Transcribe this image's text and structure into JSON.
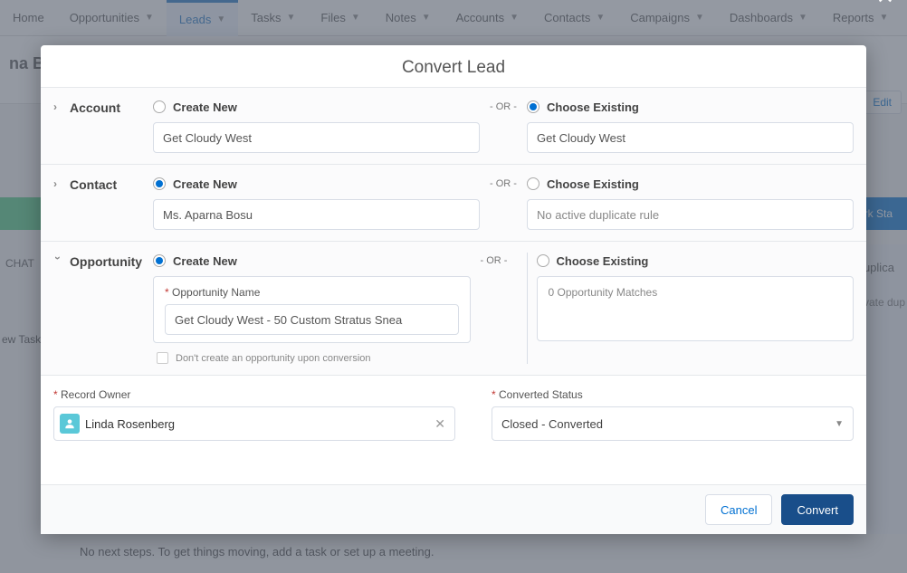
{
  "nav": {
    "items": [
      {
        "label": "Home",
        "dd": false
      },
      {
        "label": "Opportunities",
        "dd": true
      },
      {
        "label": "Leads",
        "dd": true,
        "active": true
      },
      {
        "label": "Tasks",
        "dd": true
      },
      {
        "label": "Files",
        "dd": true
      },
      {
        "label": "Notes",
        "dd": true
      },
      {
        "label": "Accounts",
        "dd": true
      },
      {
        "label": "Contacts",
        "dd": true
      },
      {
        "label": "Campaigns",
        "dd": true
      },
      {
        "label": "Dashboards",
        "dd": true
      },
      {
        "label": "Reports",
        "dd": true
      }
    ]
  },
  "bg": {
    "lead_name": "na Bos",
    "edit_btn": "Edit",
    "mark_stage": "ark Sta",
    "chatter": "CHAT",
    "newtask": "ew Task",
    "duplicates_title": "uplica",
    "duplicates_sub": "vate dup",
    "next_steps": "No next steps. To get things moving, add a task or set up a meeting."
  },
  "modal": {
    "title": "Convert Lead",
    "or_label": "- OR -",
    "sections": {
      "account": {
        "label": "Account",
        "create_label": "Create New",
        "create_value": "Get Cloudy West",
        "choose_label": "Choose Existing",
        "choose_value": "Get Cloudy West",
        "selected": "choose"
      },
      "contact": {
        "label": "Contact",
        "create_label": "Create New",
        "create_value": "Ms. Aparna Bosu",
        "choose_label": "Choose Existing",
        "choose_value": "No active duplicate rule",
        "selected": "create"
      },
      "opportunity": {
        "label": "Opportunity",
        "create_label": "Create New",
        "opp_name_label": "Opportunity Name",
        "opp_name_value": "Get Cloudy West - 50 Custom Stratus Snea",
        "skip_label": "Don't create an opportunity upon conversion",
        "choose_label": "Choose Existing",
        "matches_text": "0 Opportunity Matches",
        "selected": "create"
      }
    },
    "owner_label": "Record Owner",
    "owner_value": "Linda Rosenberg",
    "status_label": "Converted Status",
    "status_value": "Closed - Converted",
    "cancel": "Cancel",
    "convert": "Convert"
  }
}
